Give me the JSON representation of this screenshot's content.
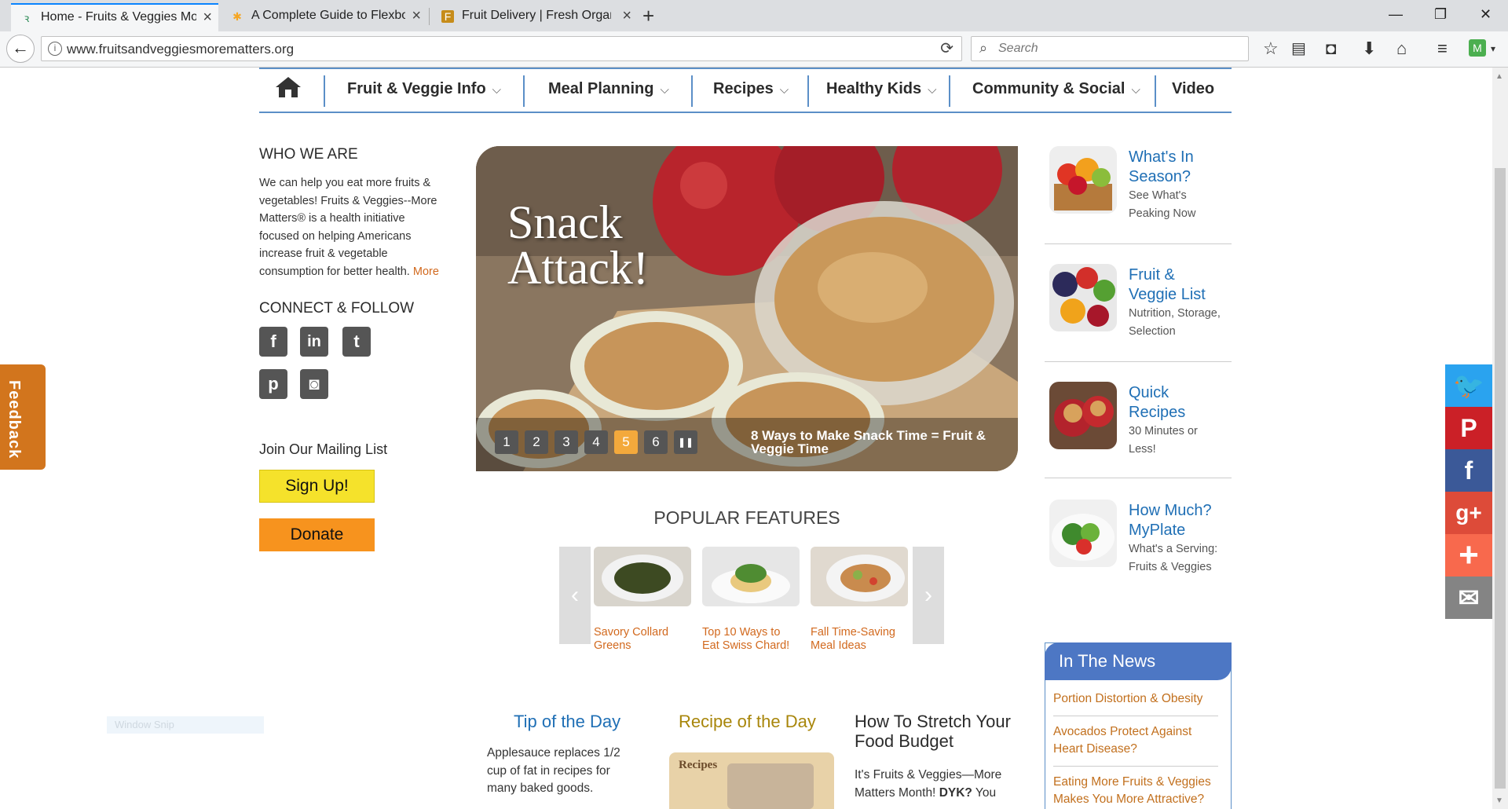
{
  "browser": {
    "tabs": [
      {
        "title": "Home - Fruits & Veggies More Matters",
        "active": true
      },
      {
        "title": "A Complete Guide to Flexbox",
        "active": false
      },
      {
        "title": "Fruit Delivery | Fresh Organic",
        "active": false
      }
    ],
    "new_tab": "+",
    "window_controls": {
      "minimize": "—",
      "restore": "❐",
      "close": "✕"
    },
    "url": "www.fruitsandveggiesmorematters.org",
    "search_placeholder": "Search",
    "toolbar_icons": [
      "star-icon",
      "reader-icon",
      "pocket-icon",
      "download-icon",
      "home-icon",
      "menu-icon",
      "extension-icon"
    ]
  },
  "nav": {
    "items": [
      {
        "label": "Fruit & Veggie Info",
        "dropdown": true
      },
      {
        "label": "Meal Planning",
        "dropdown": true
      },
      {
        "label": "Recipes",
        "dropdown": true
      },
      {
        "label": "Healthy Kids",
        "dropdown": true
      },
      {
        "label": "Community & Social",
        "dropdown": true
      },
      {
        "label": "Video",
        "dropdown": false
      }
    ]
  },
  "left": {
    "who_heading": "WHO WE ARE",
    "who_text": "We can help you eat more fruits & vegetables! Fruits & Veggies--More Matters® is a health initiative focused on helping Americans increase fruit & vegetable consumption for better health.",
    "who_more": "More",
    "connect_heading": "CONNECT & FOLLOW",
    "social": {
      "facebook": "f",
      "linkedin": "in",
      "twitter": "t",
      "pinterest": "p",
      "instagram": "◙"
    },
    "mailing_heading": "Join Our Mailing List",
    "signup_label": "Sign Up!",
    "donate_label": "Donate"
  },
  "hero": {
    "title_line1": "Snack",
    "title_line2": "Attack!",
    "slides": [
      "1",
      "2",
      "3",
      "4",
      "5",
      "6"
    ],
    "current_slide": 5,
    "pause": "❚❚",
    "caption": "8 Ways to Make Snack Time = Fruit & Veggie Time"
  },
  "popular": {
    "heading": "POPULAR FEATURES",
    "prev": "‹",
    "next": "›",
    "items": [
      {
        "label": "Savory Collard Greens"
      },
      {
        "label": "Top 10 Ways to Eat Swiss Chard!"
      },
      {
        "label": "Fall Time-Saving Meal Ideas"
      }
    ]
  },
  "right": {
    "features": [
      {
        "title": "What's In Season?",
        "subtitle": "See What's Peaking Now"
      },
      {
        "title": "Fruit & Veggie List",
        "subtitle": "Nutrition, Storage, Selection"
      },
      {
        "title": "Quick Recipes",
        "subtitle": "30 Minutes or Less!"
      },
      {
        "title": "How Much? MyPlate",
        "subtitle": "What's a Serving: Fruits & Veggies"
      }
    ],
    "news_heading": "In The News",
    "news": [
      {
        "label": "Portion Distortion & Obesity"
      },
      {
        "label": "Avocados Protect Against Heart Disease?"
      },
      {
        "label": "Eating More Fruits & Veggies Makes You More Attractive?"
      }
    ]
  },
  "bottom": {
    "tip_heading": "Tip of the Day",
    "tip_text": "Applesauce replaces 1/2 cup of fat in recipes for many baked goods.",
    "recipe_heading": "Recipe of the Day",
    "recipe_image_label": "Recipes",
    "stretch_heading": "How To Stretch Your Food Budget",
    "stretch_text_a": "It's Fruits & Veggies—More Matters Month!",
    "stretch_text_b": "DYK?",
    "stretch_text_c": "You"
  },
  "feedback_label": "Feedback",
  "share": {
    "twitter": "🐦",
    "pinterest": "P",
    "facebook": "f",
    "googleplus": "g+",
    "more": "+",
    "email": "✉"
  },
  "snip_label": "Window Snip",
  "colors": {
    "accent_blue": "#5b8fc7",
    "link_orange": "#d2691e",
    "feedback_orange": "#d2751d",
    "news_blue": "#4d77c4",
    "signup_yellow": "#f5e22b",
    "donate_orange": "#f7931e"
  }
}
